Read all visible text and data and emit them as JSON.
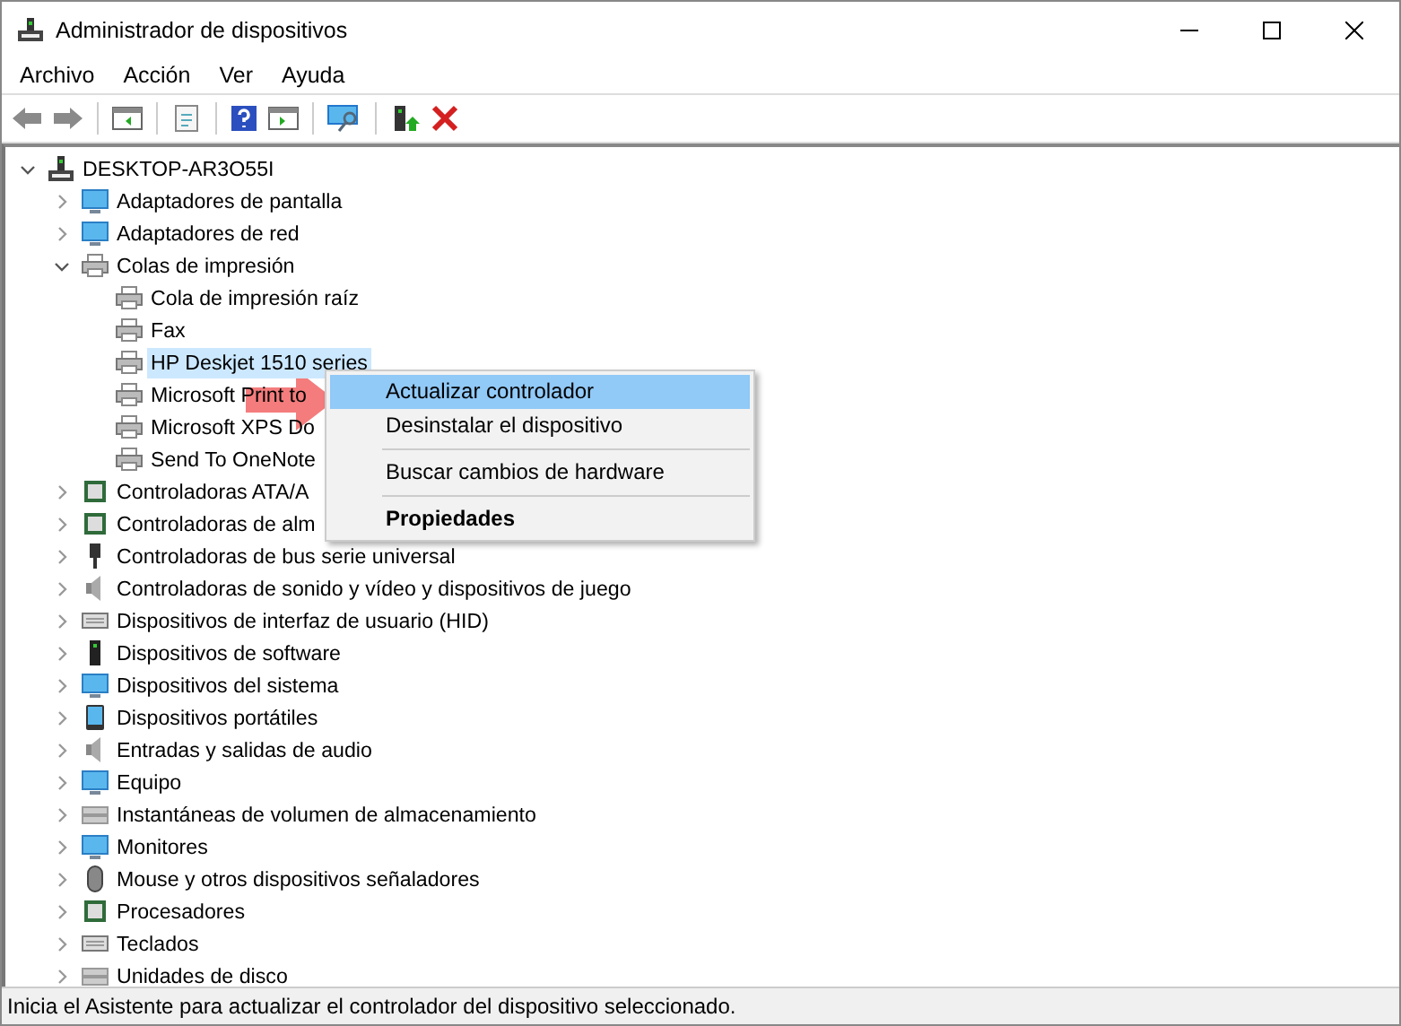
{
  "window": {
    "title": "Administrador de dispositivos"
  },
  "menu_bar": [
    "Archivo",
    "Acción",
    "Ver",
    "Ayuda"
  ],
  "tree": {
    "root": {
      "label": "DESKTOP-AR3O55I",
      "kind": "computer",
      "expanded": true,
      "selected": false,
      "children": [
        {
          "label": "Adaptadores de pantalla",
          "kind": "monitor",
          "expanded": false,
          "selected": false
        },
        {
          "label": "Adaptadores de red",
          "kind": "monitor",
          "expanded": false,
          "selected": false
        },
        {
          "label": "Colas de impresión",
          "kind": "printer",
          "expanded": true,
          "selected": false,
          "children": [
            {
              "label": "Cola de impresión raíz",
              "kind": "printer",
              "selected": false
            },
            {
              "label": "Fax",
              "kind": "printer",
              "selected": false
            },
            {
              "label": "HP Deskjet 1510 series",
              "kind": "printer",
              "selected": true
            },
            {
              "label": "Microsoft Print to",
              "kind": "printer",
              "selected": false
            },
            {
              "label": "Microsoft XPS Do",
              "kind": "printer",
              "selected": false
            },
            {
              "label": "Send To OneNote",
              "kind": "printer",
              "selected": false
            }
          ]
        },
        {
          "label": "Controladoras ATA/A",
          "kind": "chip",
          "expanded": false,
          "selected": false
        },
        {
          "label": "Controladoras de alm",
          "kind": "chip",
          "expanded": false,
          "selected": false
        },
        {
          "label": "Controladoras de bus serie universal",
          "kind": "plug",
          "expanded": false,
          "selected": false
        },
        {
          "label": "Controladoras de sonido y vídeo y dispositivos de juego",
          "kind": "speaker",
          "expanded": false,
          "selected": false
        },
        {
          "label": "Dispositivos de interfaz de usuario (HID)",
          "kind": "keyboard",
          "expanded": false,
          "selected": false
        },
        {
          "label": "Dispositivos de software",
          "kind": "tower",
          "expanded": false,
          "selected": false
        },
        {
          "label": "Dispositivos del sistema",
          "kind": "monitor",
          "expanded": false,
          "selected": false
        },
        {
          "label": "Dispositivos portátiles",
          "kind": "tablet",
          "expanded": false,
          "selected": false
        },
        {
          "label": "Entradas y salidas de audio",
          "kind": "speaker",
          "expanded": false,
          "selected": false
        },
        {
          "label": "Equipo",
          "kind": "monitor",
          "expanded": false,
          "selected": false
        },
        {
          "label": "Instantáneas de volumen de almacenamiento",
          "kind": "drive",
          "expanded": false,
          "selected": false
        },
        {
          "label": "Monitores",
          "kind": "monitor",
          "expanded": false,
          "selected": false
        },
        {
          "label": "Mouse y otros dispositivos señaladores",
          "kind": "mouse",
          "expanded": false,
          "selected": false
        },
        {
          "label": "Procesadores",
          "kind": "chip",
          "expanded": false,
          "selected": false
        },
        {
          "label": "Teclados",
          "kind": "keyboard",
          "expanded": false,
          "selected": false
        },
        {
          "label": "Unidades de disco",
          "kind": "drive",
          "expanded": false,
          "selected": false
        }
      ]
    }
  },
  "context_menu": [
    {
      "label": "Actualizar controlador",
      "selected": true,
      "default": false,
      "separator_before": false
    },
    {
      "label": "Desinstalar el dispositivo",
      "selected": false,
      "default": false,
      "separator_before": false
    },
    {
      "label": "Buscar cambios de hardware",
      "selected": false,
      "default": false,
      "separator_before": true
    },
    {
      "label": "Propiedades",
      "selected": false,
      "default": true,
      "separator_before": true
    }
  ],
  "status_bar": "Inicia el Asistente para actualizar el controlador del dispositivo seleccionado."
}
